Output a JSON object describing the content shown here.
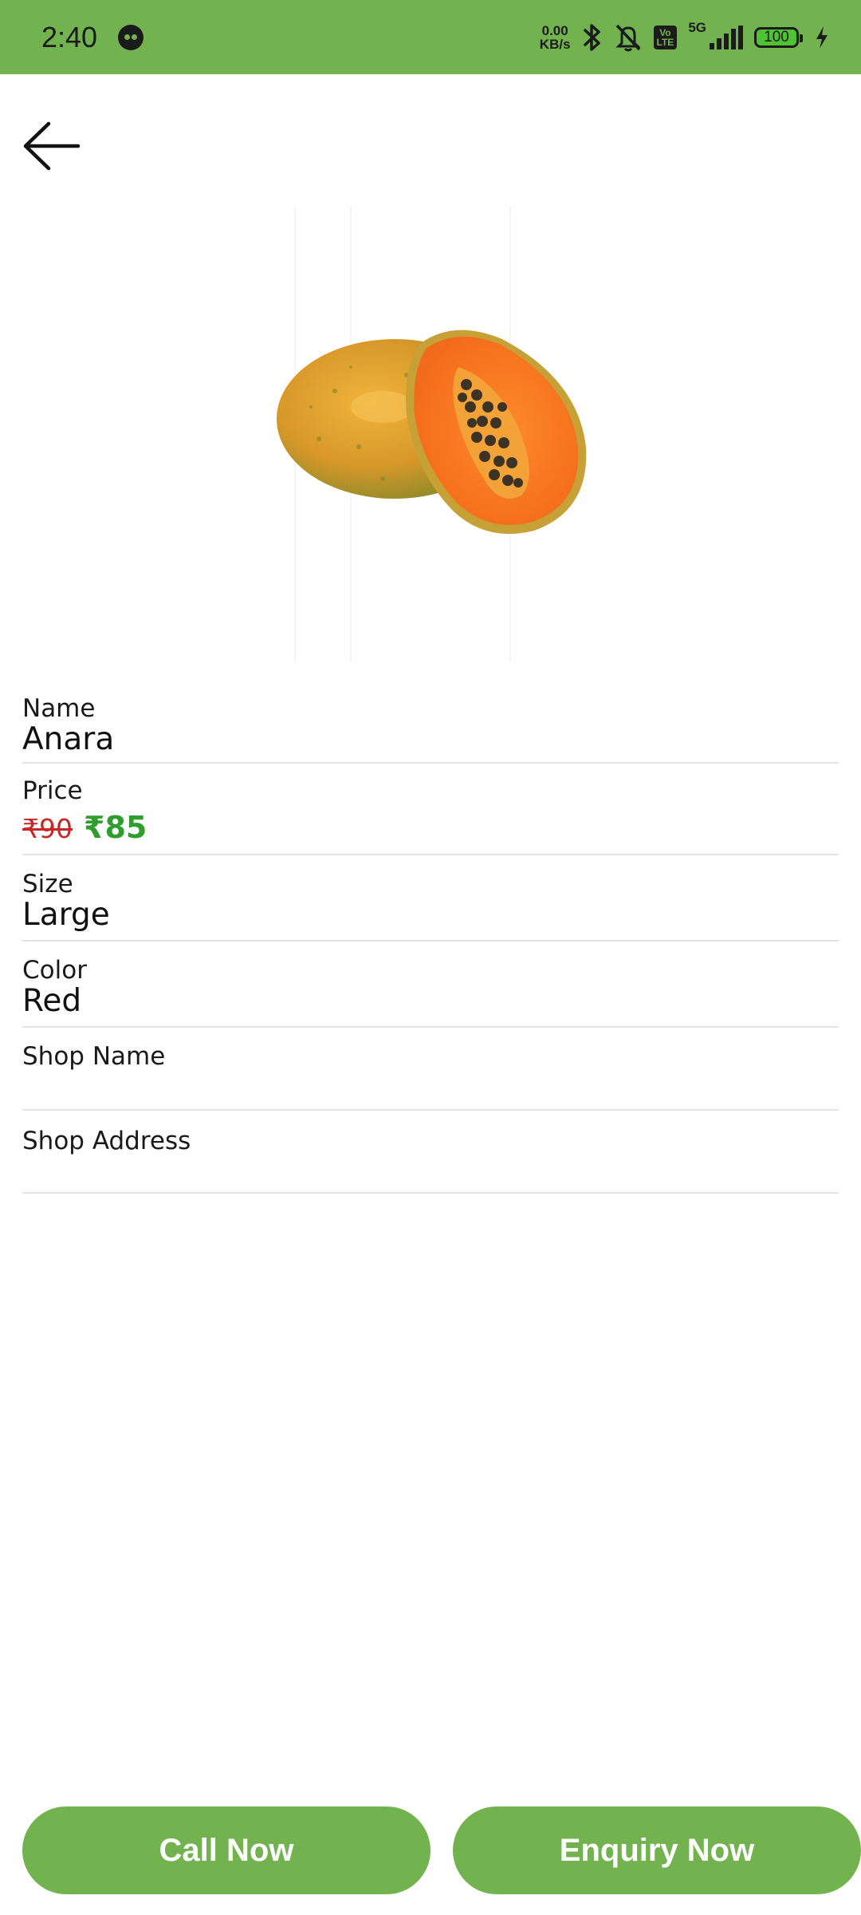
{
  "status_bar": {
    "time": "2:40",
    "net_speed_value": "0.00",
    "net_speed_unit": "KB/s",
    "lte_badge_top": "Vo",
    "lte_badge_bottom": "LTE",
    "network": "5G",
    "battery": "100"
  },
  "product": {
    "image_icon": "papaya-image",
    "name_label": "Name",
    "name_value": "Anara",
    "price_label": "Price",
    "price_old": "₹90",
    "price_new": "₹85",
    "size_label": "Size",
    "size_value": "Large",
    "color_label": "Color",
    "color_value": "Red",
    "shop_name_label": "Shop Name",
    "shop_name_value": "",
    "shop_address_label": "Shop Address",
    "shop_address_value": ""
  },
  "actions": {
    "call_label": "Call Now",
    "enquiry_label": "Enquiry Now"
  },
  "colors": {
    "accent": "#72b350",
    "price_old": "#c62828",
    "price_new": "#2f9e2f"
  }
}
